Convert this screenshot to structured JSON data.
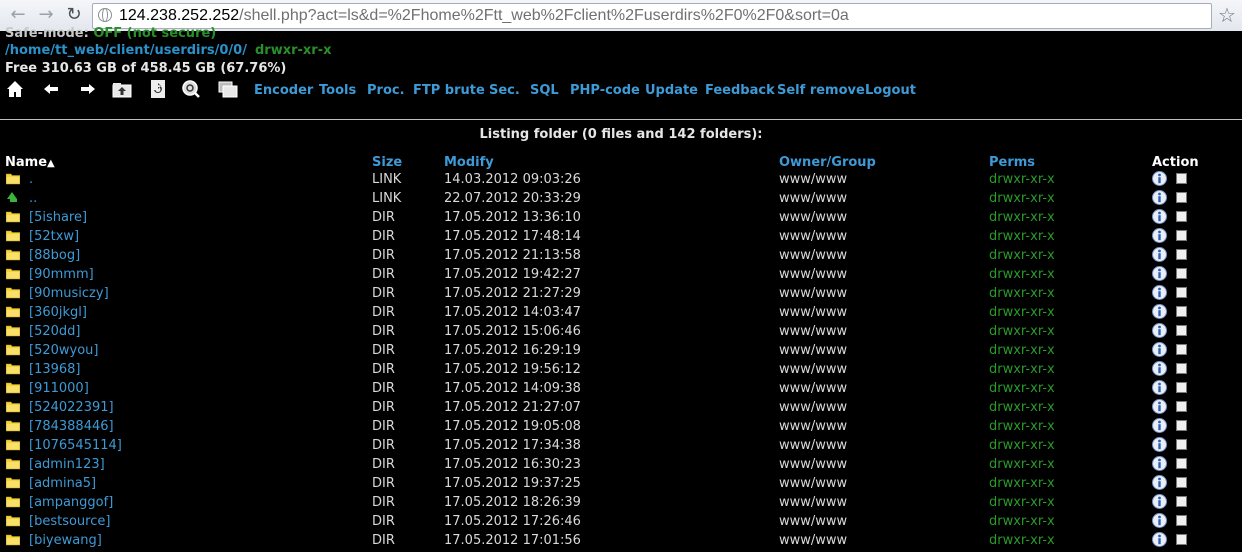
{
  "browser": {
    "url_host": "124.238.252.252",
    "url_path": "/shell.php?act=ls&d=%2Fhome%2Ftt_web%2Fclient%2Fuserdirs%2F0%2F0&sort=0a"
  },
  "shell": {
    "safe_mode_label": "Safe-mode:",
    "safe_mode_value": "OFF (not secure)",
    "cwd": "/home/tt_web/client/userdirs/0/0/",
    "cwd_perms": "drwxr-xr-x",
    "free_space": "Free 310.63 GB of 458.45 GB (67.76%)",
    "menu": [
      "Encoder",
      "Tools",
      "Proc.",
      "FTP brute",
      "Sec.",
      "SQL",
      "PHP-code",
      "Update",
      "Feedback",
      "Self remove",
      "Logout"
    ],
    "listing_title": "Listing folder (0 files and 142 folders):",
    "columns": {
      "name": "Name",
      "sort_indicator": "▲",
      "size": "Size",
      "modify": "Modify",
      "owner": "Owner/Group",
      "perms": "Perms",
      "action": "Action"
    },
    "rows": [
      {
        "icon": "folder",
        "name": ".",
        "size": "LINK",
        "modify": "14.03.2012 09:03:26",
        "owner": "www/www",
        "perms": "drwxr-xr-x"
      },
      {
        "icon": "up",
        "name": "..",
        "size": "LINK",
        "modify": "22.07.2012 20:33:29",
        "owner": "www/www",
        "perms": "drwxr-xr-x"
      },
      {
        "icon": "folder",
        "name": "[5ishare]",
        "size": "DIR",
        "modify": "17.05.2012 13:36:10",
        "owner": "www/www",
        "perms": "drwxr-xr-x"
      },
      {
        "icon": "folder",
        "name": "[52txw]",
        "size": "DIR",
        "modify": "17.05.2012 17:48:14",
        "owner": "www/www",
        "perms": "drwxr-xr-x"
      },
      {
        "icon": "folder",
        "name": "[88bog]",
        "size": "DIR",
        "modify": "17.05.2012 21:13:58",
        "owner": "www/www",
        "perms": "drwxr-xr-x"
      },
      {
        "icon": "folder",
        "name": "[90mmm]",
        "size": "DIR",
        "modify": "17.05.2012 19:42:27",
        "owner": "www/www",
        "perms": "drwxr-xr-x"
      },
      {
        "icon": "folder",
        "name": "[90musiczy]",
        "size": "DIR",
        "modify": "17.05.2012 21:27:29",
        "owner": "www/www",
        "perms": "drwxr-xr-x"
      },
      {
        "icon": "folder",
        "name": "[360jkgl]",
        "size": "DIR",
        "modify": "17.05.2012 14:03:47",
        "owner": "www/www",
        "perms": "drwxr-xr-x"
      },
      {
        "icon": "folder",
        "name": "[520dd]",
        "size": "DIR",
        "modify": "17.05.2012 15:06:46",
        "owner": "www/www",
        "perms": "drwxr-xr-x"
      },
      {
        "icon": "folder",
        "name": "[520wyou]",
        "size": "DIR",
        "modify": "17.05.2012 16:29:19",
        "owner": "www/www",
        "perms": "drwxr-xr-x"
      },
      {
        "icon": "folder",
        "name": "[13968]",
        "size": "DIR",
        "modify": "17.05.2012 19:56:12",
        "owner": "www/www",
        "perms": "drwxr-xr-x"
      },
      {
        "icon": "folder",
        "name": "[911000]",
        "size": "DIR",
        "modify": "17.05.2012 14:09:38",
        "owner": "www/www",
        "perms": "drwxr-xr-x"
      },
      {
        "icon": "folder",
        "name": "[524022391]",
        "size": "DIR",
        "modify": "17.05.2012 21:27:07",
        "owner": "www/www",
        "perms": "drwxr-xr-x"
      },
      {
        "icon": "folder",
        "name": "[784388446]",
        "size": "DIR",
        "modify": "17.05.2012 19:05:08",
        "owner": "www/www",
        "perms": "drwxr-xr-x"
      },
      {
        "icon": "folder",
        "name": "[1076545114]",
        "size": "DIR",
        "modify": "17.05.2012 17:34:38",
        "owner": "www/www",
        "perms": "drwxr-xr-x"
      },
      {
        "icon": "folder",
        "name": "[admin123]",
        "size": "DIR",
        "modify": "17.05.2012 16:30:23",
        "owner": "www/www",
        "perms": "drwxr-xr-x"
      },
      {
        "icon": "folder",
        "name": "[admina5]",
        "size": "DIR",
        "modify": "17.05.2012 19:37:25",
        "owner": "www/www",
        "perms": "drwxr-xr-x"
      },
      {
        "icon": "folder",
        "name": "[ampanggof]",
        "size": "DIR",
        "modify": "17.05.2012 18:26:39",
        "owner": "www/www",
        "perms": "drwxr-xr-x"
      },
      {
        "icon": "folder",
        "name": "[bestsource]",
        "size": "DIR",
        "modify": "17.05.2012 17:26:46",
        "owner": "www/www",
        "perms": "drwxr-xr-x"
      },
      {
        "icon": "folder",
        "name": "[biyewang]",
        "size": "DIR",
        "modify": "17.05.2012 17:01:56",
        "owner": "www/www",
        "perms": "drwxr-xr-x"
      }
    ]
  }
}
